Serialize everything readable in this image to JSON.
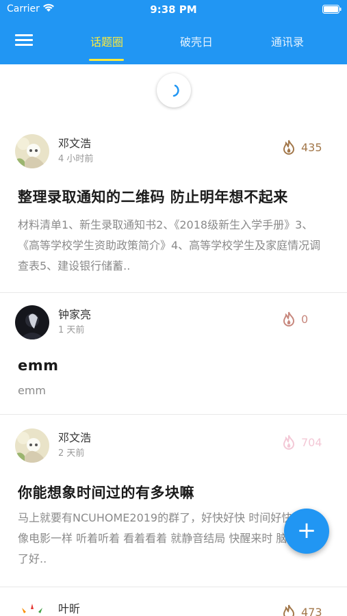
{
  "status_bar": {
    "carrier": "Carrier",
    "time": "9:38 PM"
  },
  "tabs": [
    {
      "label": "话题圈",
      "active": true
    },
    {
      "label": "破壳日",
      "active": false
    },
    {
      "label": "通讯录",
      "active": false
    }
  ],
  "posts": [
    {
      "author": "邓文浩",
      "time": "4 小时前",
      "heat": "435",
      "title": "整理录取通知的二维码 防止明年想不起来",
      "body": "材料清单1、新生录取通知书2、《2018级新生入学手册》3、《高等学校学生资助政策简介》4、高等学校学生及家庭情况调查表5、建设银行储蓄.."
    },
    {
      "author": "钟家亮",
      "time": "1 天前",
      "heat": "0",
      "title": "emm",
      "body": "emm"
    },
    {
      "author": "邓文浩",
      "time": "2 天前",
      "heat": "704",
      "title": "你能想象时间过的有多块嘛",
      "body": "马上就要有NCUHOME2019的群了，好快好快 时间好快 一样 像电影一样 听着听着 看着看着 就静音结局 快醒来时 脑海里想了好.."
    },
    {
      "author": "叶昕",
      "heat": "473"
    }
  ],
  "colors": {
    "primary": "#2196f3",
    "accent": "#ffeb3b"
  },
  "fab": {
    "label": "+"
  }
}
